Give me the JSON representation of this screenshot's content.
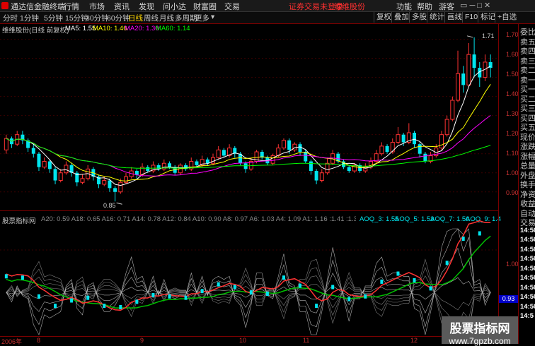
{
  "menubar": {
    "app_title": "通达信金融终端",
    "items": [
      "行情",
      "市场",
      "资讯",
      "发现",
      "问小达",
      "财富圈",
      "交易"
    ],
    "notice": "证券交易未登录",
    "stock_name": "维维股份",
    "right_items": [
      "功能",
      "帮助",
      "游客"
    ]
  },
  "toolbar": {
    "tabs": [
      "分时",
      "1分钟",
      "5分钟",
      "15分钟",
      "30分钟",
      "60分钟",
      "日线",
      "周线",
      "月线",
      "多周期",
      "更多"
    ],
    "active_tab": "日线",
    "right_buttons": [
      "复权",
      "叠加",
      "多股",
      "统计",
      "画线",
      "F10",
      "标记",
      "+自选"
    ]
  },
  "main_legend": {
    "stock": "维维股份(日线 前复权)",
    "ma5": "MA5: 1.55",
    "ma10": "MA10: 1.46",
    "ma20": "MA20: 1.30",
    "ma60": "MA60: 1.14"
  },
  "ind_legend": {
    "name": "股票指标网",
    "values": "A20: 0.59  A18: 0.65  A16: 0.71  A14: 0.78  A12: 0.84  A10: 0.90  A8: 0.97  A6: 1.03  A4: 1.09  A1: 1.16  :1.41  :1.35  :1.31  :1.27  :1.25",
    "aoq3": "AOQ_3: 1.55",
    "aoq5": "AOQ_5: 1.53",
    "aoq7": "AOQ_7: 1.50",
    "aoq9": "AOQ_9: 1.4"
  },
  "main_axis": [
    "1.70",
    "1.60",
    "1.50",
    "1.40",
    "1.30",
    "1.20",
    "1.10",
    "1.00",
    "0.90"
  ],
  "ind_axis": [
    "1.00"
  ],
  "ind_marker": "0.93",
  "price_annotations": {
    "high": "1.71",
    "low": "0.85"
  },
  "time_axis": [
    "2006年",
    "8",
    "9",
    "10",
    "11",
    "12"
  ],
  "right_panel": [
    "委比",
    "卖五",
    "卖四",
    "卖三",
    "卖二",
    "卖一",
    "买一",
    "买二",
    "买三",
    "买四",
    "买五",
    "现价",
    "涨跌",
    "涨幅",
    "总量",
    "外盘",
    "换手",
    "净资",
    "收益",
    "自动",
    "交易",
    "14:50",
    "14:50",
    "14:50",
    "14:50",
    "14:50",
    "14:50",
    "14:50",
    "14:50",
    "14:50",
    "14:5"
  ],
  "watermark": {
    "title": "股票指标网",
    "url": "www.7gpzb.com"
  },
  "colors": {
    "up": "#ff3232",
    "down": "#00e5ee",
    "ma5": "#ffffff",
    "ma10": "#ffff00",
    "ma20": "#ff00ff",
    "ma60": "#00ff00",
    "axis": "#7a0000"
  },
  "chart_data": {
    "type": "candlestick",
    "title": "维维股份(日线 前复权)",
    "ylim": [
      0.84,
      1.75
    ],
    "candles": [
      [
        1.12,
        1.18,
        1.2,
        1.1
      ],
      [
        1.18,
        1.15,
        1.19,
        1.13
      ],
      [
        1.15,
        1.2,
        1.22,
        1.14
      ],
      [
        1.2,
        1.17,
        1.22,
        1.15
      ],
      [
        1.17,
        1.13,
        1.18,
        1.11
      ],
      [
        1.13,
        1.1,
        1.15,
        1.08
      ],
      [
        1.1,
        1.03,
        1.11,
        1.01
      ],
      [
        1.03,
        1.06,
        1.08,
        1.02
      ],
      [
        1.06,
        1.02,
        1.07,
        1.0
      ],
      [
        1.02,
        0.96,
        1.03,
        0.94
      ],
      [
        0.96,
        1.0,
        1.02,
        0.95
      ],
      [
        1.0,
        1.04,
        1.06,
        0.99
      ],
      [
        1.04,
        1.0,
        1.05,
        0.98
      ],
      [
        1.0,
        0.95,
        1.01,
        0.93
      ],
      [
        0.95,
        0.97,
        0.99,
        0.94
      ],
      [
        0.97,
        1.02,
        1.04,
        0.96
      ],
      [
        1.02,
        0.98,
        1.03,
        0.96
      ],
      [
        0.98,
        0.94,
        0.99,
        0.92
      ],
      [
        0.94,
        0.96,
        0.98,
        0.93
      ],
      [
        0.96,
        0.92,
        0.97,
        0.9
      ],
      [
        0.92,
        0.9,
        0.93,
        0.85
      ],
      [
        0.9,
        0.95,
        0.97,
        0.89
      ],
      [
        0.95,
        0.98,
        1.0,
        0.94
      ],
      [
        0.98,
        1.01,
        1.03,
        0.97
      ],
      [
        1.01,
        0.99,
        1.02,
        0.97
      ],
      [
        0.99,
        1.03,
        1.05,
        0.98
      ],
      [
        1.03,
        1.01,
        1.04,
        1.0
      ],
      [
        1.01,
        1.04,
        1.06,
        1.0
      ],
      [
        1.04,
        1.02,
        1.05,
        1.01
      ],
      [
        1.02,
        1.05,
        1.07,
        1.01
      ],
      [
        1.05,
        1.03,
        1.06,
        1.02
      ],
      [
        1.03,
        1.0,
        1.04,
        0.99
      ],
      [
        1.0,
        1.04,
        1.05,
        0.99
      ],
      [
        1.04,
        1.02,
        1.05,
        1.01
      ],
      [
        1.02,
        1.06,
        1.08,
        1.01
      ],
      [
        1.06,
        1.04,
        1.07,
        1.03
      ],
      [
        1.04,
        1.07,
        1.09,
        1.03
      ],
      [
        1.07,
        1.05,
        1.08,
        1.04
      ],
      [
        1.05,
        1.08,
        1.1,
        1.04
      ],
      [
        1.08,
        1.12,
        1.14,
        1.07
      ],
      [
        1.12,
        1.09,
        1.13,
        1.08
      ],
      [
        1.09,
        1.13,
        1.15,
        1.08
      ],
      [
        1.13,
        1.1,
        1.14,
        1.08
      ],
      [
        1.1,
        1.05,
        1.11,
        1.04
      ],
      [
        1.05,
        1.02,
        1.06,
        1.0
      ],
      [
        1.02,
        1.06,
        1.08,
        1.01
      ],
      [
        1.06,
        1.11,
        1.12,
        1.05
      ],
      [
        1.11,
        1.08,
        1.12,
        1.07
      ],
      [
        1.08,
        1.05,
        1.09,
        1.04
      ],
      [
        1.05,
        1.09,
        1.1,
        1.04
      ],
      [
        1.09,
        1.13,
        1.15,
        1.08
      ],
      [
        1.13,
        1.17,
        1.18,
        1.12
      ],
      [
        1.17,
        1.12,
        1.18,
        1.1
      ],
      [
        1.12,
        1.15,
        1.16,
        1.11
      ],
      [
        1.15,
        1.11,
        1.16,
        1.09
      ],
      [
        1.11,
        1.06,
        1.12,
        1.05
      ],
      [
        1.06,
        1.01,
        1.07,
        0.99
      ],
      [
        1.01,
        0.96,
        1.02,
        0.94
      ],
      [
        0.96,
        1.0,
        1.02,
        0.95
      ],
      [
        1.0,
        1.05,
        1.08,
        0.99
      ],
      [
        1.05,
        1.1,
        1.12,
        1.04
      ],
      [
        1.1,
        1.06,
        1.11,
        1.05
      ],
      [
        1.06,
        1.03,
        1.07,
        1.02
      ],
      [
        1.03,
        1.01,
        1.04,
        1.0
      ],
      [
        1.01,
        1.04,
        1.05,
        1.0
      ],
      [
        1.04,
        1.01,
        1.05,
        1.0
      ],
      [
        1.01,
        1.03,
        1.05,
        1.0
      ],
      [
        1.03,
        1.06,
        1.08,
        1.02
      ],
      [
        1.06,
        1.1,
        1.12,
        1.05
      ],
      [
        1.1,
        1.14,
        1.16,
        1.09
      ],
      [
        1.14,
        1.11,
        1.15,
        1.1
      ],
      [
        1.11,
        1.16,
        1.18,
        1.1
      ],
      [
        1.16,
        1.2,
        1.24,
        1.15
      ],
      [
        1.2,
        1.16,
        1.21,
        1.14
      ],
      [
        1.16,
        1.21,
        1.26,
        1.15
      ],
      [
        1.21,
        1.15,
        1.22,
        1.13
      ],
      [
        1.15,
        1.1,
        1.16,
        1.08
      ],
      [
        1.1,
        1.06,
        1.11,
        1.05
      ],
      [
        1.06,
        1.09,
        1.11,
        1.05
      ],
      [
        1.09,
        1.13,
        1.15,
        1.08
      ],
      [
        1.13,
        1.2,
        1.22,
        1.12
      ],
      [
        1.2,
        1.28,
        1.3,
        1.19
      ],
      [
        1.28,
        1.38,
        1.4,
        1.27
      ],
      [
        1.38,
        1.52,
        1.64,
        1.37
      ],
      [
        1.52,
        1.46,
        1.56,
        1.42
      ],
      [
        1.46,
        1.62,
        1.68,
        1.45
      ],
      [
        1.62,
        1.55,
        1.71,
        1.5
      ],
      [
        1.55,
        1.5,
        1.58,
        1.45
      ],
      [
        1.5,
        1.58,
        1.62,
        1.48
      ],
      [
        1.58,
        1.55,
        1.62,
        1.5
      ]
    ]
  }
}
